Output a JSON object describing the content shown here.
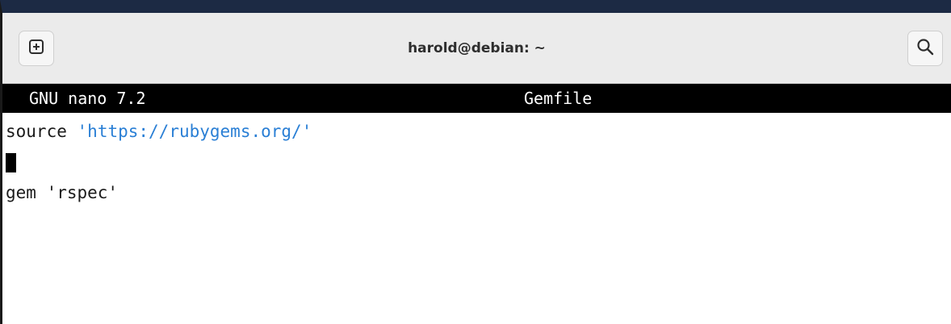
{
  "window": {
    "title": "harold@debian: ~",
    "new_tab_icon": "new-tab-plus-box-icon",
    "search_icon": "magnifier-icon"
  },
  "nano": {
    "version": "GNU nano 7.2",
    "filename": "Gemfile"
  },
  "editor": {
    "line1_keyword": "source ",
    "line1_q1": "'",
    "line1_url": "https://rubygems.org/",
    "line1_q2": "'",
    "line3": "gem 'rspec'"
  },
  "colors": {
    "string": "#2a7fd5",
    "nano_bar_bg": "#000000",
    "titlebar_bg": "#ebebeb"
  }
}
